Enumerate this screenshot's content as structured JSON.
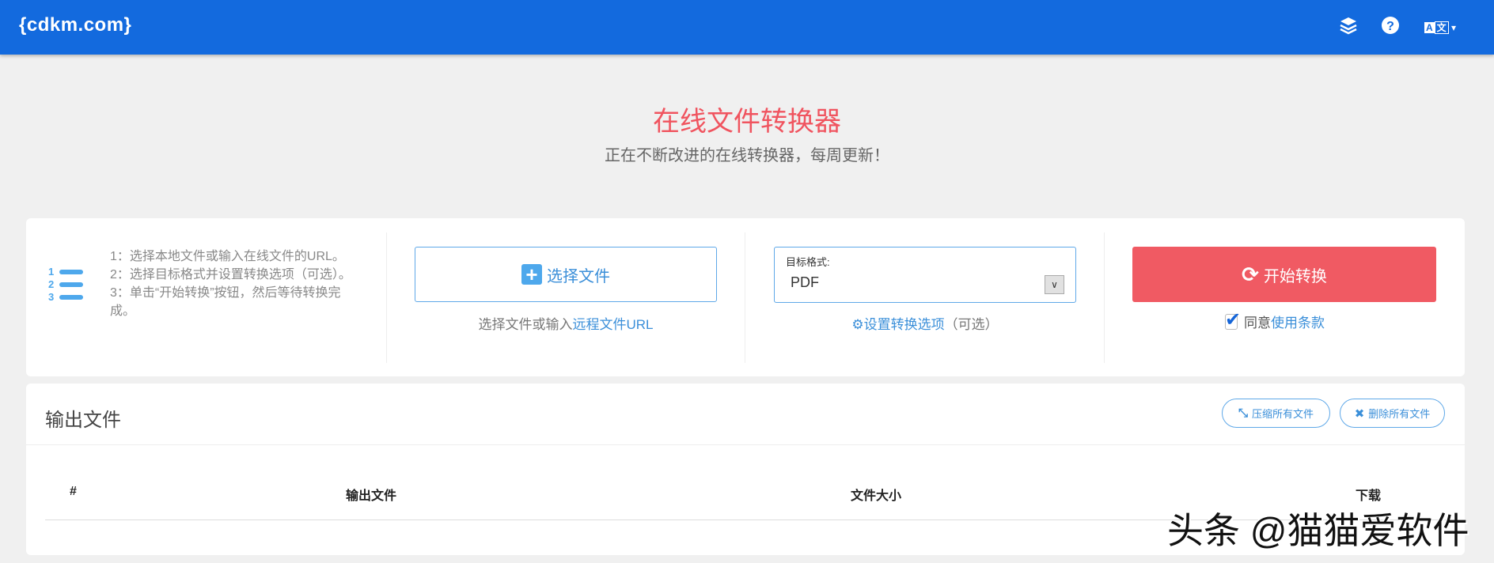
{
  "header": {
    "logo": "{cdkm.com}",
    "icons": [
      "layers-icon",
      "help-icon",
      "language-icon"
    ]
  },
  "hero": {
    "title": "在线文件转换器",
    "subtitle": "正在不断改进的在线转换器，每周更新！"
  },
  "steps": {
    "text": "1：选择本地文件或输入在线文件的URL。2：选择目标格式并设置转换选项（可选）。3：单击“开始转换”按钮，然后等待转换完成。"
  },
  "choose": {
    "button": "选择文件",
    "hint_prefix": "选择文件或输入",
    "hint_link": "远程文件URL"
  },
  "format": {
    "label": "目标格式:",
    "value": "PDF",
    "options_link": "设置转换选项",
    "options_suffix": "（可选）"
  },
  "start": {
    "button": "开始转换",
    "agree_prefix": "同意",
    "terms_link": "使用条款",
    "agreed": true
  },
  "output": {
    "title": "输出文件",
    "compress_button": "压缩所有文件",
    "delete_button": "删除所有文件",
    "columns": [
      "#",
      "输出文件",
      "文件大小",
      "下载"
    ]
  },
  "watermark": "头条 @猫猫爱软件",
  "colors": {
    "header": "#136ade",
    "accent": "#f05a63",
    "link": "#3b8fd9"
  }
}
